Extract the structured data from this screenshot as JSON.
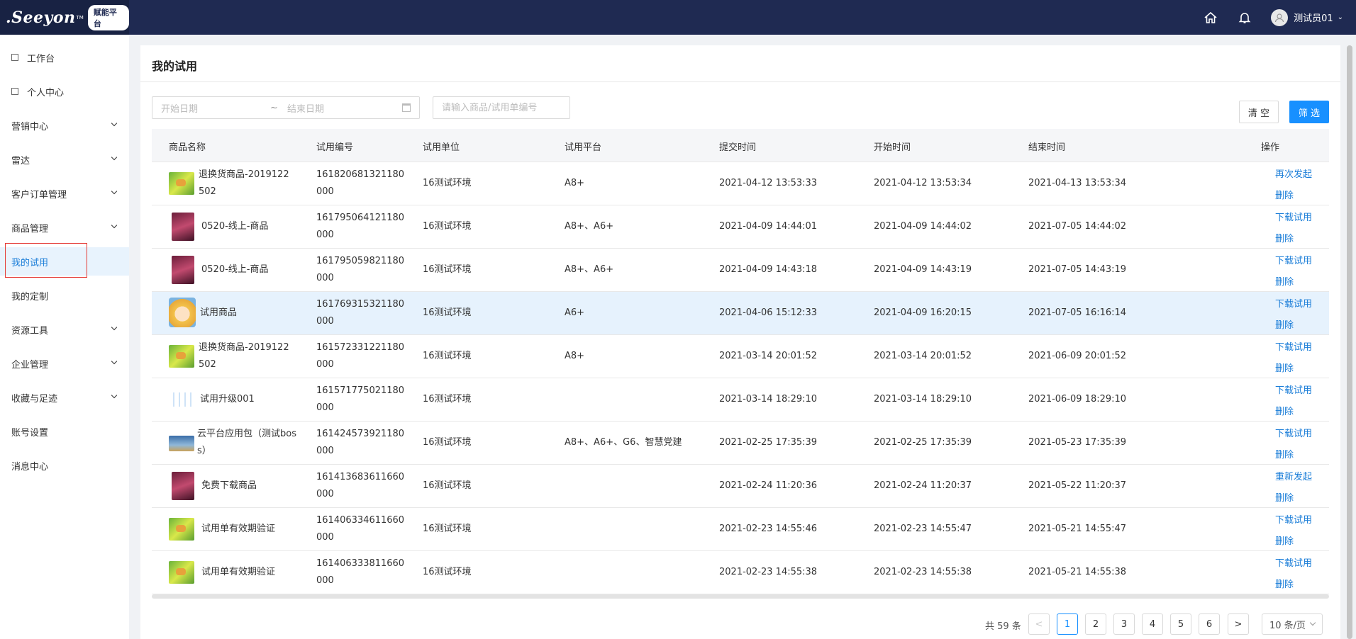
{
  "header": {
    "logo_text": ".Seeyon",
    "logo_tm": "TM",
    "platform_badge": "赋能平台",
    "home_icon": "home-icon",
    "bell_icon": "bell-icon",
    "user_name": "测试员01",
    "caret": "⌄"
  },
  "sidebar": {
    "items": [
      {
        "label": "工作台"
      },
      {
        "label": "个人中心"
      },
      {
        "label": "营销中心"
      },
      {
        "label": "雷达"
      },
      {
        "label": "客户订单管理"
      },
      {
        "label": "商品管理"
      },
      {
        "label": "我的试用"
      },
      {
        "label": "我的定制"
      },
      {
        "label": "资源工具"
      },
      {
        "label": "企业管理"
      },
      {
        "label": "收藏与足迹"
      },
      {
        "label": "账号设置"
      },
      {
        "label": "消息中心"
      }
    ]
  },
  "page": {
    "title": "我的试用",
    "date_start_placeholder": "开始日期",
    "date_sep": "~",
    "date_end_placeholder": "结束日期",
    "search_placeholder": "请输入商品/试用单编号",
    "clear_label": "清 空",
    "filter_label": "筛 选"
  },
  "table": {
    "columns": [
      "商品名称",
      "试用编号",
      "试用单位",
      "试用平台",
      "提交时间",
      "开始时间",
      "结束时间",
      "操作"
    ],
    "rows": [
      {
        "name": "退换货商品-2019122502",
        "id": "161820681321180000",
        "unit": "16测试环境",
        "platform": "A8+",
        "submit": "2021-04-12 13:53:33",
        "start": "2021-04-12 13:53:34",
        "end": "2021-04-13 13:53:34",
        "action1": "再次发起",
        "action2": "删除"
      },
      {
        "name": "0520-线上-商品",
        "id": "161795064121180000",
        "unit": "16测试环境",
        "platform": "A8+、A6+",
        "submit": "2021-04-09 14:44:01",
        "start": "2021-04-09 14:44:02",
        "end": "2021-07-05 14:44:02",
        "action1": "下载试用",
        "action2": "删除"
      },
      {
        "name": "0520-线上-商品",
        "id": "161795059821180000",
        "unit": "16测试环境",
        "platform": "A8+、A6+",
        "submit": "2021-04-09 14:43:18",
        "start": "2021-04-09 14:43:19",
        "end": "2021-07-05 14:43:19",
        "action1": "下载试用",
        "action2": "删除"
      },
      {
        "name": "试用商品",
        "id": "161769315321180000",
        "unit": "16测试环境",
        "platform": "A6+",
        "submit": "2021-04-06 15:12:33",
        "start": "2021-04-09 16:20:15",
        "end": "2021-07-05 16:16:14",
        "action1": "下载试用",
        "action2": "删除"
      },
      {
        "name": "退换货商品-2019122502",
        "id": "161572331221180000",
        "unit": "16测试环境",
        "platform": "A8+",
        "submit": "2021-03-14 20:01:52",
        "start": "2021-03-14 20:01:52",
        "end": "2021-06-09 20:01:52",
        "action1": "下载试用",
        "action2": "删除"
      },
      {
        "name": "试用升级001",
        "id": "161571775021180000",
        "unit": "16测试环境",
        "platform": "",
        "submit": "2021-03-14 18:29:10",
        "start": "2021-03-14 18:29:10",
        "end": "2021-06-09 18:29:10",
        "action1": "下载试用",
        "action2": "删除"
      },
      {
        "name": "云平台应用包（测试boss）",
        "id": "161424573921180000",
        "unit": "16测试环境",
        "platform": "A8+、A6+、G6、智慧党建",
        "submit": "2021-02-25 17:35:39",
        "start": "2021-02-25 17:35:39",
        "end": "2021-05-23 17:35:39",
        "action1": "下载试用",
        "action2": "删除"
      },
      {
        "name": "免费下载商品",
        "id": "161413683611660000",
        "unit": "16测试环境",
        "platform": "",
        "submit": "2021-02-24 11:20:36",
        "start": "2021-02-24 11:20:37",
        "end": "2021-05-22 11:20:37",
        "action1": "重新发起",
        "action2": "删除"
      },
      {
        "name": "试用单有效期验证",
        "id": "161406334611660000",
        "unit": "16测试环境",
        "platform": "",
        "submit": "2021-02-23 14:55:46",
        "start": "2021-02-23 14:55:47",
        "end": "2021-05-21 14:55:47",
        "action1": "下载试用",
        "action2": "删除"
      },
      {
        "name": "试用单有效期验证",
        "id": "161406333811660000",
        "unit": "16测试环境",
        "platform": "",
        "submit": "2021-02-23 14:55:38",
        "start": "2021-02-23 14:55:38",
        "end": "2021-05-21 14:55:38",
        "action1": "下载试用",
        "action2": "删除"
      }
    ]
  },
  "pagination": {
    "total": "共 59 条",
    "prev": "<",
    "pages": [
      "1",
      "2",
      "3",
      "4",
      "5",
      "6"
    ],
    "next": ">",
    "page_size": "10 条/页"
  }
}
